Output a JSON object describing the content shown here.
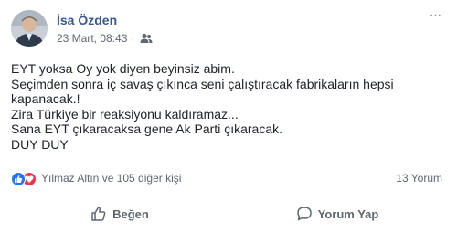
{
  "post": {
    "author": "İsa Özden",
    "timestamp": "23 Mart, 08:43",
    "separator": "·",
    "audience_icon": "friends-icon",
    "options_icon": "more-options-icon",
    "lines": [
      "EYT yoksa Oy yok diyen beyinsiz abim.",
      "Seçimden sonra iç savaş çıkınca seni çalıştıracak fabrikaların hepsi",
      "kapanacak.!",
      "Zira Türkiye bir reaksiyonu kaldıramaz...",
      "Sana EYT çıkaracaksa gene Ak Parti çıkaracak.",
      "DUY DUY"
    ]
  },
  "reactions": {
    "icons": [
      "like-reaction-icon",
      "love-reaction-icon"
    ],
    "summary": "Yılmaz Altın ve 105 diğer kişi",
    "comments": "13 Yorum"
  },
  "actions": {
    "like_label": "Beğen",
    "comment_label": "Yorum Yap"
  },
  "colors": {
    "author": "#365899",
    "meta": "#606770",
    "like_reaction": "#2078f4",
    "love_reaction": "#f0324c",
    "divider": "#dadde1"
  }
}
